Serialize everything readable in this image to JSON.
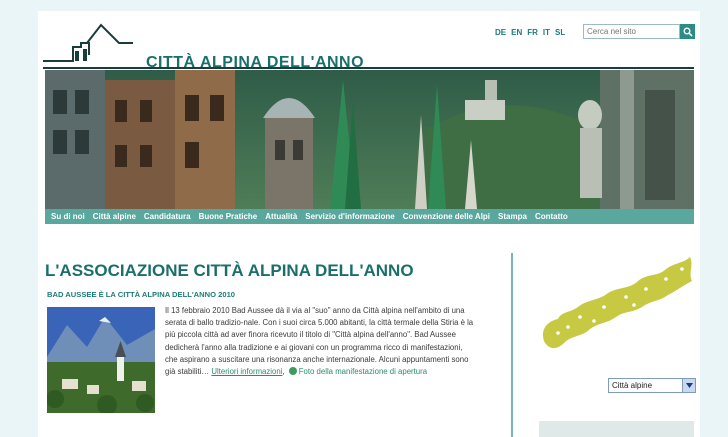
{
  "colors": {
    "accent": "#1b6f6a",
    "nav": "#5aa79e",
    "map": "#c7c943"
  },
  "header": {
    "logo_text": "CITTÀ ALPINA DELL'ANNO",
    "languages": [
      "DE",
      "EN",
      "FR",
      "IT",
      "SL"
    ],
    "search": {
      "placeholder": "Cerca nel sito"
    }
  },
  "nav": {
    "items": [
      "Su di noi",
      "Città alpine",
      "Candidatura",
      "Buone Pratiche",
      "Attualità",
      "Servizio d'informazione",
      "Convenzione delle Alpi",
      "Stampa",
      "Contatto"
    ]
  },
  "main": {
    "title": "L'ASSOCIAZIONE CITTÀ ALPINA DELL'ANNO",
    "article_heading": "BAD AUSSEE È LA CITTÀ ALPINA DELL'ANNO 2010",
    "article_body": "Il 13 febbraio 2010 Bad Aussee dà il via al \"suo\" anno da Città alpina nell'ambito di una serata di ballo tradizio-nale. Con i suoi circa 5.000 abitanti, la città termale della Stiria è la più piccola città ad aver finora ricevuto il titolo di \"Città alpina dell'anno\". Bad Aussee dedicherà l'anno alla tradizione e ai giovani con un programma ricco di manifestazioni, che aspirano a suscitare una risonanza anche internazionale. Alcuni appuntamenti sono già stabiliti…",
    "more_link": "Ulteriori informazioni",
    "photo_link": "Foto della manifestazione di apertura"
  },
  "sidebar": {
    "select_value": "Città alpine"
  }
}
